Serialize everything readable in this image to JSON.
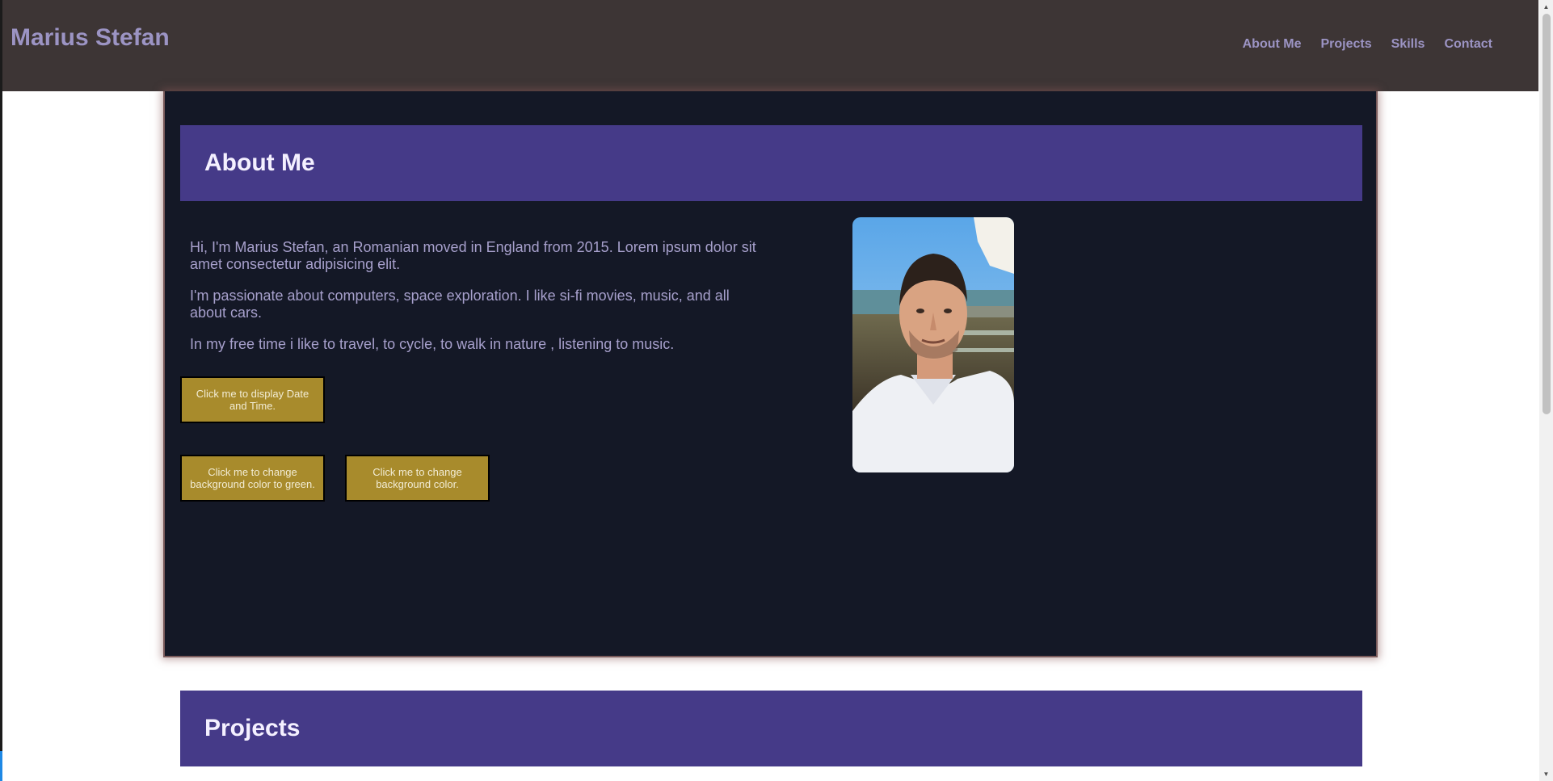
{
  "header": {
    "brand": "Marius Stefan",
    "nav": [
      "About Me",
      "Projects",
      "Skills",
      "Contact"
    ]
  },
  "about": {
    "title": "About Me",
    "paragraphs": [
      "Hi, I'm Marius Stefan, an Romanian moved in England from 2015. Lorem ipsum dolor sit amet consectetur adipisicing elit.",
      "I'm passionate about computers, space exploration. I like si-fi movies, music, and all about cars.",
      "In my free time i like to travel, to cycle, to walk in nature , listening to music."
    ],
    "buttons": {
      "date": "Click me to display Date and Time.",
      "green": "Click me to change background color to green.",
      "color": "Click me to change background color."
    }
  },
  "projects": {
    "title": "Projects"
  },
  "colors": {
    "header_bg": "#3d3535",
    "panel_bg": "#141826",
    "banner_bg": "#453a88",
    "button_bg": "#a88b2c",
    "text_accent": "#a7a0cc"
  }
}
